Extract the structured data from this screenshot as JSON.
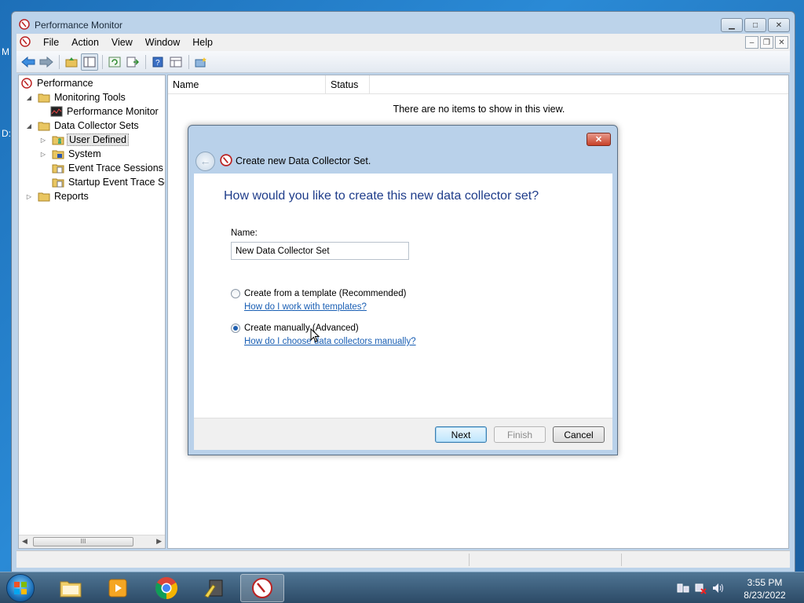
{
  "desktop": {
    "edge_text_1": "M",
    "edge_text_2": "D:"
  },
  "window": {
    "title": "Performance Monitor",
    "menu": [
      "File",
      "Action",
      "View",
      "Window",
      "Help"
    ]
  },
  "tree": {
    "items": [
      {
        "label": "Performance",
        "icon": "perfmon-icon"
      },
      {
        "label": "Monitoring Tools",
        "icon": "folder-icon"
      },
      {
        "label": "Performance Monitor",
        "icon": "chart-icon"
      },
      {
        "label": "Data Collector Sets",
        "icon": "folder-icon"
      },
      {
        "label": "User Defined",
        "icon": "user-folder-icon"
      },
      {
        "label": "System",
        "icon": "system-folder-icon"
      },
      {
        "label": "Event Trace Sessions",
        "icon": "trace-folder-icon"
      },
      {
        "label": "Startup Event Trace Ses",
        "icon": "trace-folder-icon"
      },
      {
        "label": "Reports",
        "icon": "folder-icon"
      }
    ],
    "scroll_thumb_glyph": "III"
  },
  "list": {
    "columns": [
      "Name",
      "Status"
    ],
    "empty_message": "There are no items to show in this view."
  },
  "dialog": {
    "title": "Create new Data Collector Set.",
    "heading": "How would you like to create this new data collector set?",
    "name_label": "Name:",
    "name_value": "New Data Collector Set",
    "option_template": "Create from a template (Recommended)",
    "link_template": "How do I work with templates?",
    "option_manual": "Create manually (Advanced)",
    "link_manual": "How do I choose data collectors manually?",
    "selected_option": "manual",
    "buttons": {
      "next": "Next",
      "finish": "Finish",
      "cancel": "Cancel"
    }
  },
  "taskbar": {
    "time": "3:55 PM",
    "date": "8/23/2022",
    "apps": [
      "explorer-icon",
      "media-player-icon",
      "chrome-icon",
      "tools-icon",
      "perfmon-icon"
    ]
  },
  "colors": {
    "heading_blue": "#1e3c8a",
    "link_blue": "#1a5fb4",
    "window_frame": "#bcd3ea"
  }
}
